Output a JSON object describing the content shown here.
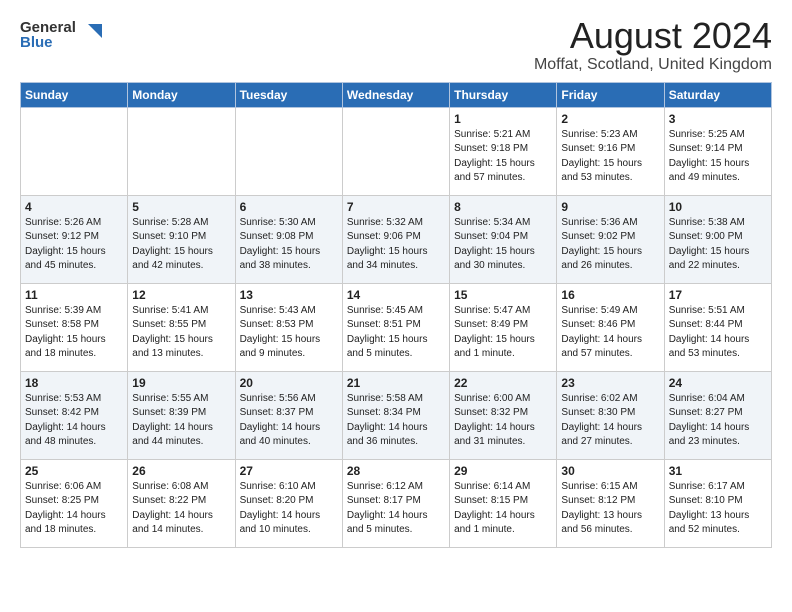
{
  "header": {
    "logo_general": "General",
    "logo_blue": "Blue",
    "title": "August 2024",
    "subtitle": "Moffat, Scotland, United Kingdom"
  },
  "days_of_week": [
    "Sunday",
    "Monday",
    "Tuesday",
    "Wednesday",
    "Thursday",
    "Friday",
    "Saturday"
  ],
  "weeks": [
    [
      {
        "day": "",
        "info": ""
      },
      {
        "day": "",
        "info": ""
      },
      {
        "day": "",
        "info": ""
      },
      {
        "day": "",
        "info": ""
      },
      {
        "day": "1",
        "info": "Sunrise: 5:21 AM\nSunset: 9:18 PM\nDaylight: 15 hours\nand 57 minutes."
      },
      {
        "day": "2",
        "info": "Sunrise: 5:23 AM\nSunset: 9:16 PM\nDaylight: 15 hours\nand 53 minutes."
      },
      {
        "day": "3",
        "info": "Sunrise: 5:25 AM\nSunset: 9:14 PM\nDaylight: 15 hours\nand 49 minutes."
      }
    ],
    [
      {
        "day": "4",
        "info": "Sunrise: 5:26 AM\nSunset: 9:12 PM\nDaylight: 15 hours\nand 45 minutes."
      },
      {
        "day": "5",
        "info": "Sunrise: 5:28 AM\nSunset: 9:10 PM\nDaylight: 15 hours\nand 42 minutes."
      },
      {
        "day": "6",
        "info": "Sunrise: 5:30 AM\nSunset: 9:08 PM\nDaylight: 15 hours\nand 38 minutes."
      },
      {
        "day": "7",
        "info": "Sunrise: 5:32 AM\nSunset: 9:06 PM\nDaylight: 15 hours\nand 34 minutes."
      },
      {
        "day": "8",
        "info": "Sunrise: 5:34 AM\nSunset: 9:04 PM\nDaylight: 15 hours\nand 30 minutes."
      },
      {
        "day": "9",
        "info": "Sunrise: 5:36 AM\nSunset: 9:02 PM\nDaylight: 15 hours\nand 26 minutes."
      },
      {
        "day": "10",
        "info": "Sunrise: 5:38 AM\nSunset: 9:00 PM\nDaylight: 15 hours\nand 22 minutes."
      }
    ],
    [
      {
        "day": "11",
        "info": "Sunrise: 5:39 AM\nSunset: 8:58 PM\nDaylight: 15 hours\nand 18 minutes."
      },
      {
        "day": "12",
        "info": "Sunrise: 5:41 AM\nSunset: 8:55 PM\nDaylight: 15 hours\nand 13 minutes."
      },
      {
        "day": "13",
        "info": "Sunrise: 5:43 AM\nSunset: 8:53 PM\nDaylight: 15 hours\nand 9 minutes."
      },
      {
        "day": "14",
        "info": "Sunrise: 5:45 AM\nSunset: 8:51 PM\nDaylight: 15 hours\nand 5 minutes."
      },
      {
        "day": "15",
        "info": "Sunrise: 5:47 AM\nSunset: 8:49 PM\nDaylight: 15 hours\nand 1 minute."
      },
      {
        "day": "16",
        "info": "Sunrise: 5:49 AM\nSunset: 8:46 PM\nDaylight: 14 hours\nand 57 minutes."
      },
      {
        "day": "17",
        "info": "Sunrise: 5:51 AM\nSunset: 8:44 PM\nDaylight: 14 hours\nand 53 minutes."
      }
    ],
    [
      {
        "day": "18",
        "info": "Sunrise: 5:53 AM\nSunset: 8:42 PM\nDaylight: 14 hours\nand 48 minutes."
      },
      {
        "day": "19",
        "info": "Sunrise: 5:55 AM\nSunset: 8:39 PM\nDaylight: 14 hours\nand 44 minutes."
      },
      {
        "day": "20",
        "info": "Sunrise: 5:56 AM\nSunset: 8:37 PM\nDaylight: 14 hours\nand 40 minutes."
      },
      {
        "day": "21",
        "info": "Sunrise: 5:58 AM\nSunset: 8:34 PM\nDaylight: 14 hours\nand 36 minutes."
      },
      {
        "day": "22",
        "info": "Sunrise: 6:00 AM\nSunset: 8:32 PM\nDaylight: 14 hours\nand 31 minutes."
      },
      {
        "day": "23",
        "info": "Sunrise: 6:02 AM\nSunset: 8:30 PM\nDaylight: 14 hours\nand 27 minutes."
      },
      {
        "day": "24",
        "info": "Sunrise: 6:04 AM\nSunset: 8:27 PM\nDaylight: 14 hours\nand 23 minutes."
      }
    ],
    [
      {
        "day": "25",
        "info": "Sunrise: 6:06 AM\nSunset: 8:25 PM\nDaylight: 14 hours\nand 18 minutes."
      },
      {
        "day": "26",
        "info": "Sunrise: 6:08 AM\nSunset: 8:22 PM\nDaylight: 14 hours\nand 14 minutes."
      },
      {
        "day": "27",
        "info": "Sunrise: 6:10 AM\nSunset: 8:20 PM\nDaylight: 14 hours\nand 10 minutes."
      },
      {
        "day": "28",
        "info": "Sunrise: 6:12 AM\nSunset: 8:17 PM\nDaylight: 14 hours\nand 5 minutes."
      },
      {
        "day": "29",
        "info": "Sunrise: 6:14 AM\nSunset: 8:15 PM\nDaylight: 14 hours\nand 1 minute."
      },
      {
        "day": "30",
        "info": "Sunrise: 6:15 AM\nSunset: 8:12 PM\nDaylight: 13 hours\nand 56 minutes."
      },
      {
        "day": "31",
        "info": "Sunrise: 6:17 AM\nSunset: 8:10 PM\nDaylight: 13 hours\nand 52 minutes."
      }
    ]
  ]
}
